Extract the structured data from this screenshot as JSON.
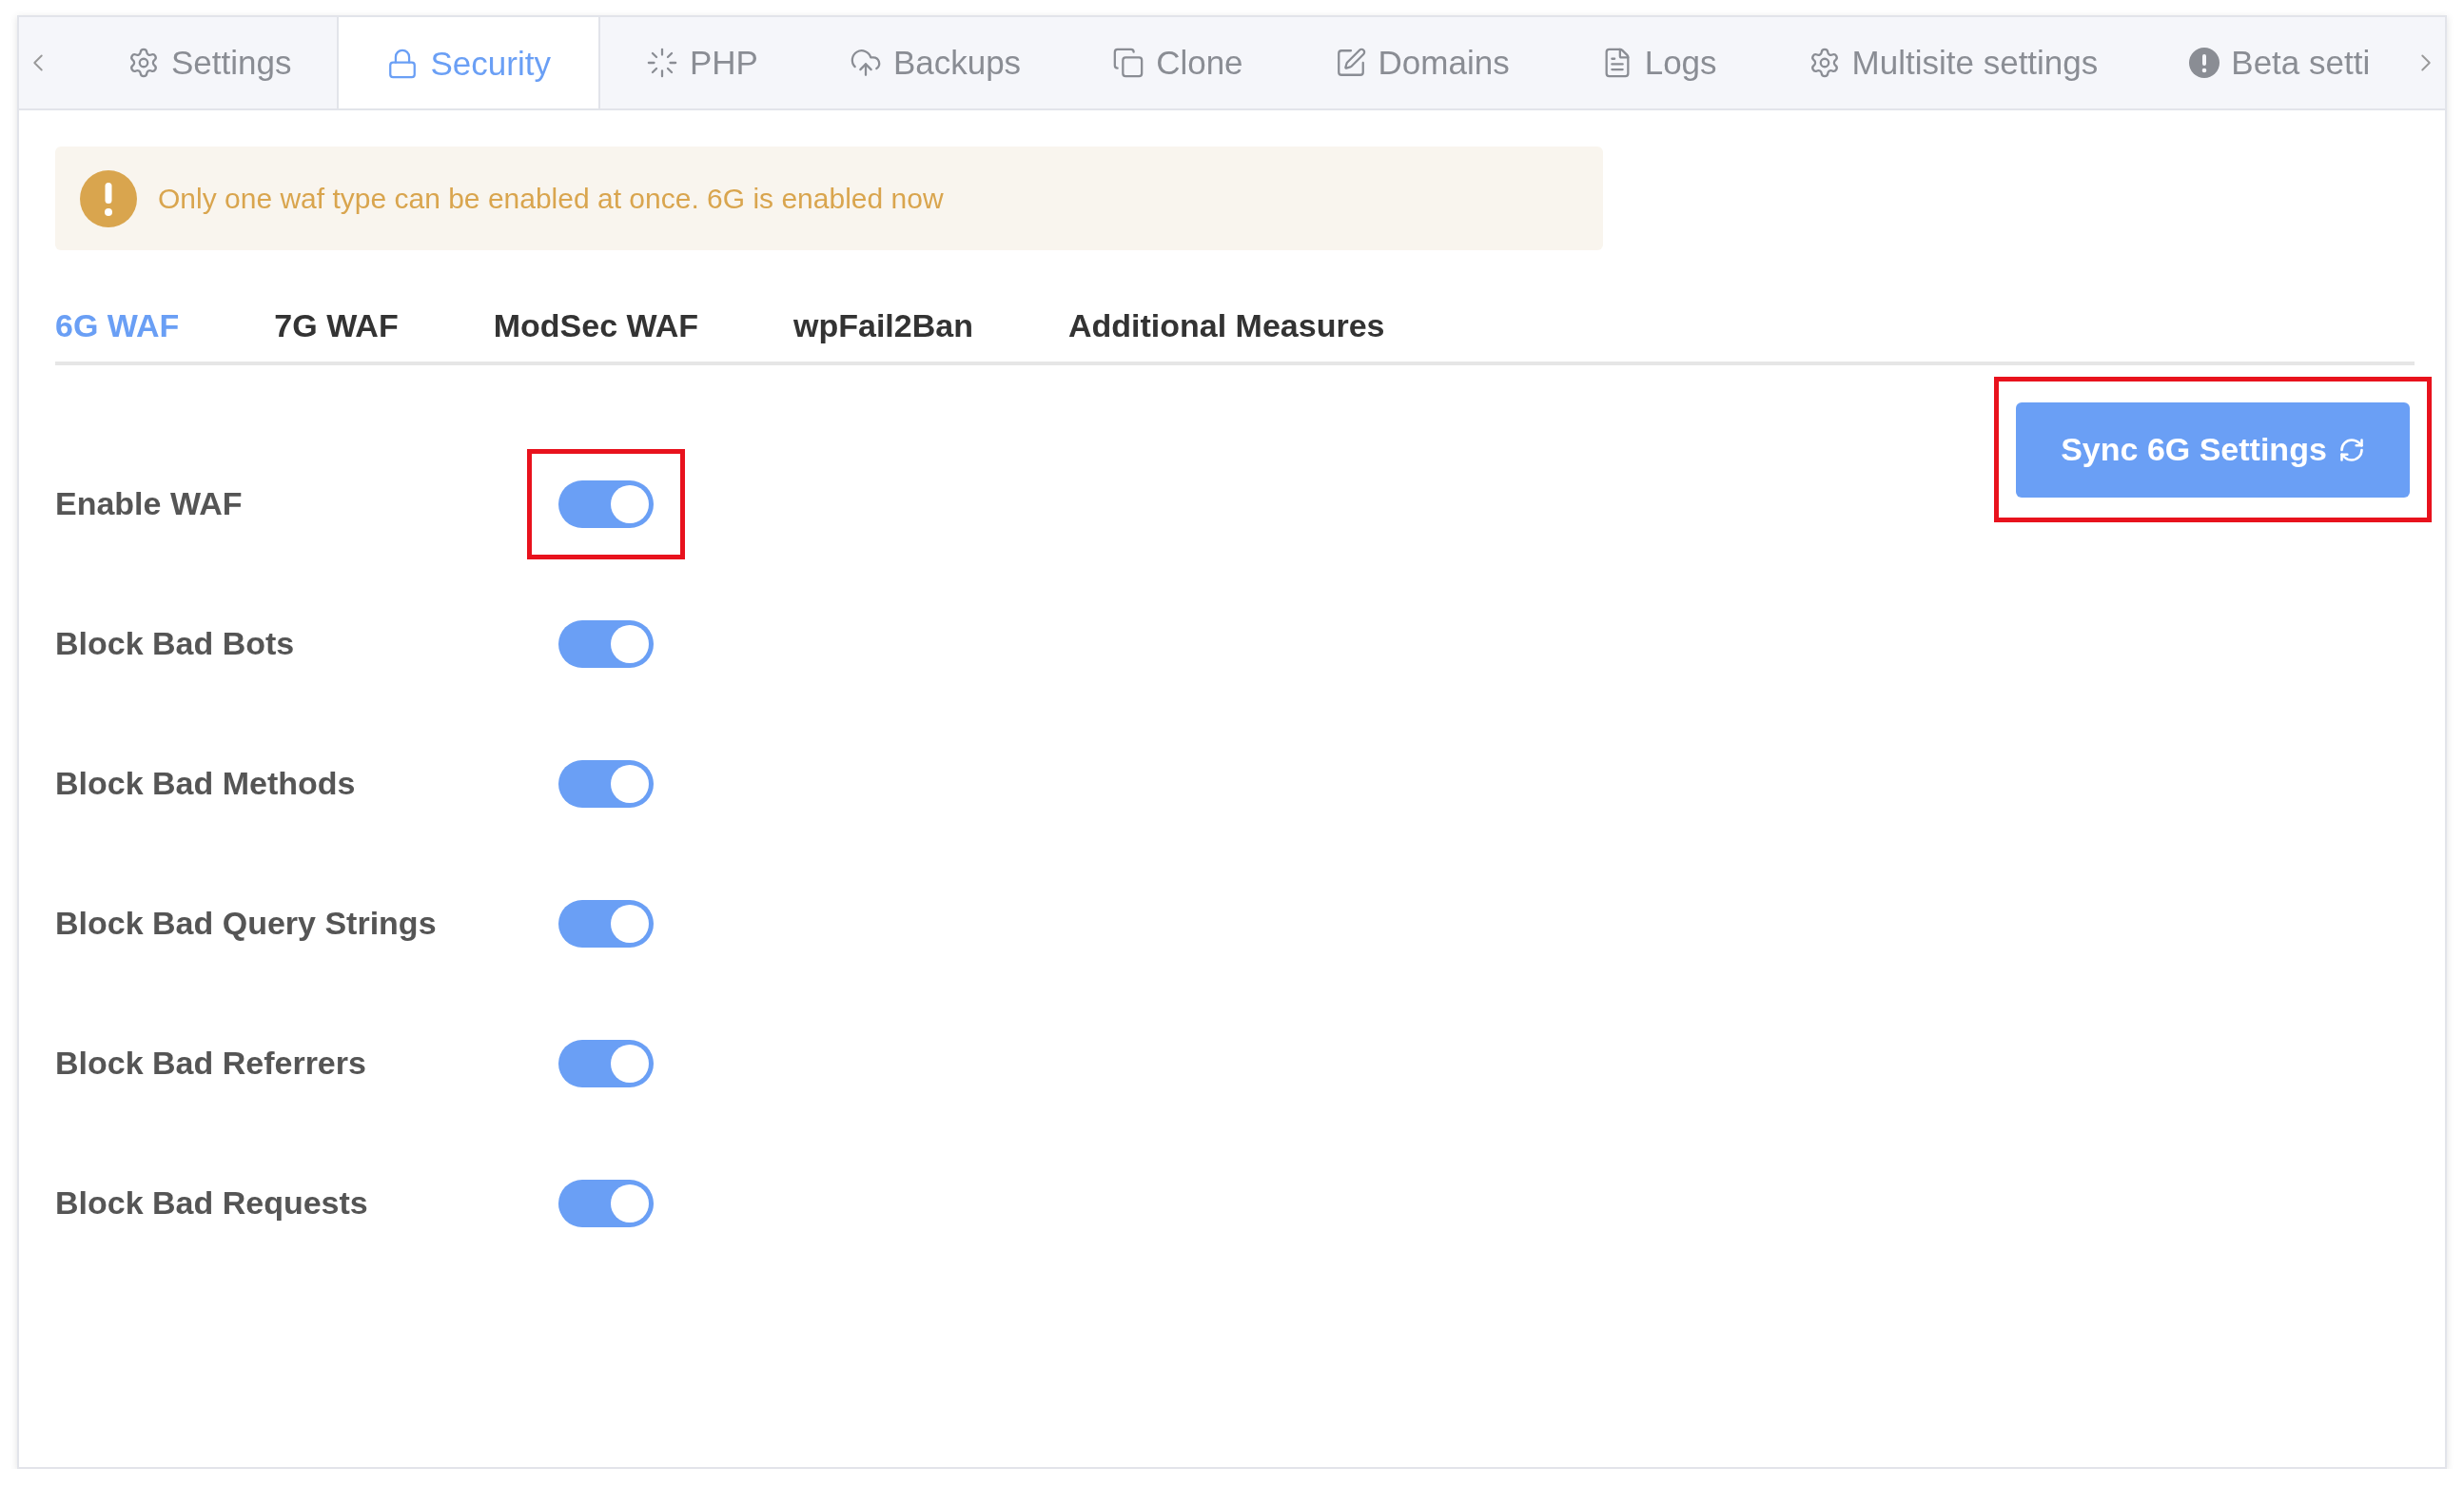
{
  "tabs": [
    {
      "label": "Settings",
      "selected": false
    },
    {
      "label": "Security",
      "selected": true
    },
    {
      "label": "PHP",
      "selected": false
    },
    {
      "label": "Backups",
      "selected": false
    },
    {
      "label": "Clone",
      "selected": false
    },
    {
      "label": "Domains",
      "selected": false
    },
    {
      "label": "Logs",
      "selected": false
    },
    {
      "label": "Multisite settings",
      "selected": false
    },
    {
      "label": "Beta setti",
      "selected": false
    }
  ],
  "alert": {
    "message": "Only one waf type can be enabled at once. 6G is enabled now"
  },
  "sub_tabs": [
    {
      "label": "6G WAF",
      "selected": true
    },
    {
      "label": "7G WAF",
      "selected": false
    },
    {
      "label": "ModSec WAF",
      "selected": false
    },
    {
      "label": "wpFail2Ban",
      "selected": false
    },
    {
      "label": "Additional Measures",
      "selected": false
    }
  ],
  "settings": [
    {
      "label": "Enable WAF",
      "on": true,
      "highlighted": true
    },
    {
      "label": "Block Bad Bots",
      "on": true,
      "highlighted": false
    },
    {
      "label": "Block Bad Methods",
      "on": true,
      "highlighted": false
    },
    {
      "label": "Block Bad Query Strings",
      "on": true,
      "highlighted": false
    },
    {
      "label": "Block Bad Referrers",
      "on": true,
      "highlighted": false
    },
    {
      "label": "Block Bad Requests",
      "on": true,
      "highlighted": false
    }
  ],
  "sync_button": {
    "label": "Sync 6G Settings",
    "highlighted": true
  }
}
